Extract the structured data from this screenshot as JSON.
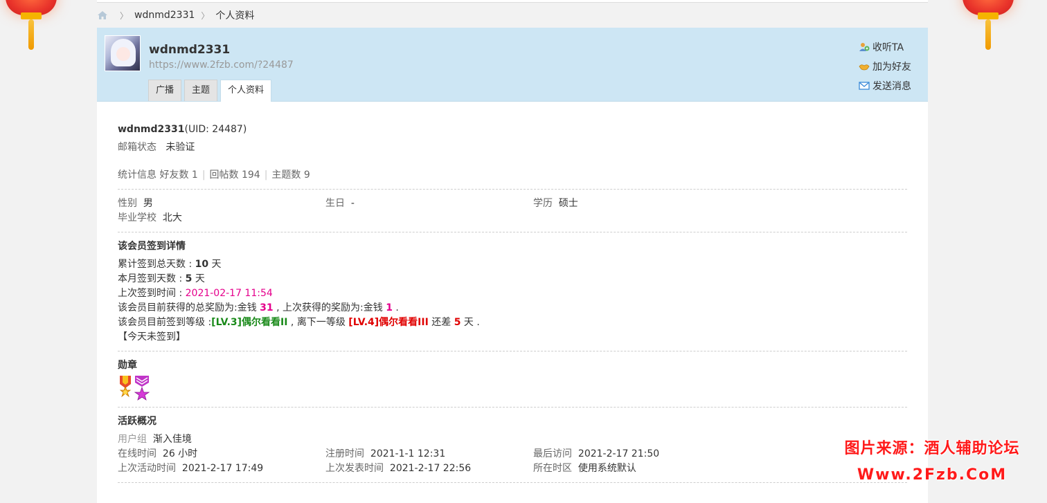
{
  "breadcrumb": {
    "user": "wdnmd2331",
    "page": "个人资料"
  },
  "header": {
    "username": "wdnmd2331",
    "url": "https://www.2fzb.com/?24487",
    "tabs": [
      "广播",
      "主题",
      "个人资料"
    ],
    "active_tab": "个人资料",
    "actions": {
      "follow": "收听TA",
      "add_friend": "加为好友",
      "send_message": "发送消息"
    }
  },
  "profile": {
    "name": "wdnmd2331",
    "uid": "(UID: 24487)",
    "email_label": "邮箱状态",
    "email_value": "未验证",
    "stats_label": "统计信息",
    "friends": "好友数 1",
    "replies": "回帖数 194",
    "threads": "主题数 9",
    "gender_label": "性别",
    "gender_value": "男",
    "birthday_label": "生日",
    "birthday_value": "-",
    "education_label": "学历",
    "education_value": "硕士",
    "school_label": "毕业学校",
    "school_value": "北大"
  },
  "signin": {
    "title": "该会员签到详情",
    "total_label": "累计签到总天数 : ",
    "total_value": "10",
    "month_label": "本月签到天数 : ",
    "month_value": "5",
    "day_unit": " 天",
    "last_label": "上次签到时间 : ",
    "last_value": "2021-02-17 11:54",
    "reward_prefix": "该会员目前获得的总奖励为:金钱 ",
    "reward_total": "31",
    "reward_mid": " , 上次获得的奖励为:金钱 ",
    "reward_last": "1",
    "reward_end": " .",
    "level_prefix": "该会员目前签到等级 :",
    "level_current": "[LV.3]偶尔看看II",
    "level_mid": " , 离下一等级 ",
    "level_next": "[LV.4]偶尔看看III",
    "level_diff_label": " 还差 ",
    "level_diff": "5",
    "level_end": " 天 .",
    "today": "【今天未签到】"
  },
  "medals": {
    "title": "勋章"
  },
  "activity": {
    "title": "活跃概况",
    "group_label": "用户组",
    "group_value": "渐入佳境",
    "online_label": "在线时间",
    "online_value": "26 小时",
    "register_label": "注册时间",
    "register_value": "2021-1-1 12:31",
    "lastvisit_label": "最后访问",
    "lastvisit_value": "2021-2-17 21:50",
    "lastactive_label": "上次活动时间",
    "lastactive_value": "2021-2-17 17:49",
    "lastpost_label": "上次发表时间",
    "lastpost_value": "2021-2-17 22:56",
    "timezone_label": "所在时区",
    "timezone_value": "使用系统默认"
  },
  "watermark": {
    "line1": "图片来源：酒人辅助论坛",
    "line2": "Www.2Fzb.CoM"
  },
  "colors": {
    "header_bg": "#cde6f4",
    "pink": "#e5008c",
    "green": "#1a8a1a",
    "red": "#e00000"
  }
}
